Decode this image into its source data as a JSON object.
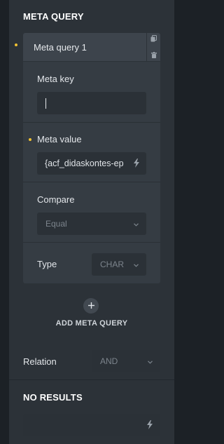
{
  "meta_query": {
    "title": "META QUERY",
    "item_title": "Meta query 1",
    "meta_key": {
      "label": "Meta key",
      "value": ""
    },
    "meta_value": {
      "label": "Meta value",
      "value": "{acf_didaskontes-ep"
    },
    "compare": {
      "label": "Compare",
      "value": "Equal"
    },
    "type": {
      "label": "Type",
      "value": "CHAR"
    },
    "add_label": "ADD META QUERY"
  },
  "relation": {
    "label": "Relation",
    "value": "AND"
  },
  "no_results": {
    "title": "NO RESULTS",
    "value": ""
  },
  "colors": {
    "panel": "#2c3238",
    "field": "#2b3137",
    "indicator": "#f1c232"
  },
  "icons": [
    "copy-icon",
    "trash-icon",
    "dynamic-data-bolt-icon",
    "chevron-down-icon",
    "plus-icon"
  ]
}
